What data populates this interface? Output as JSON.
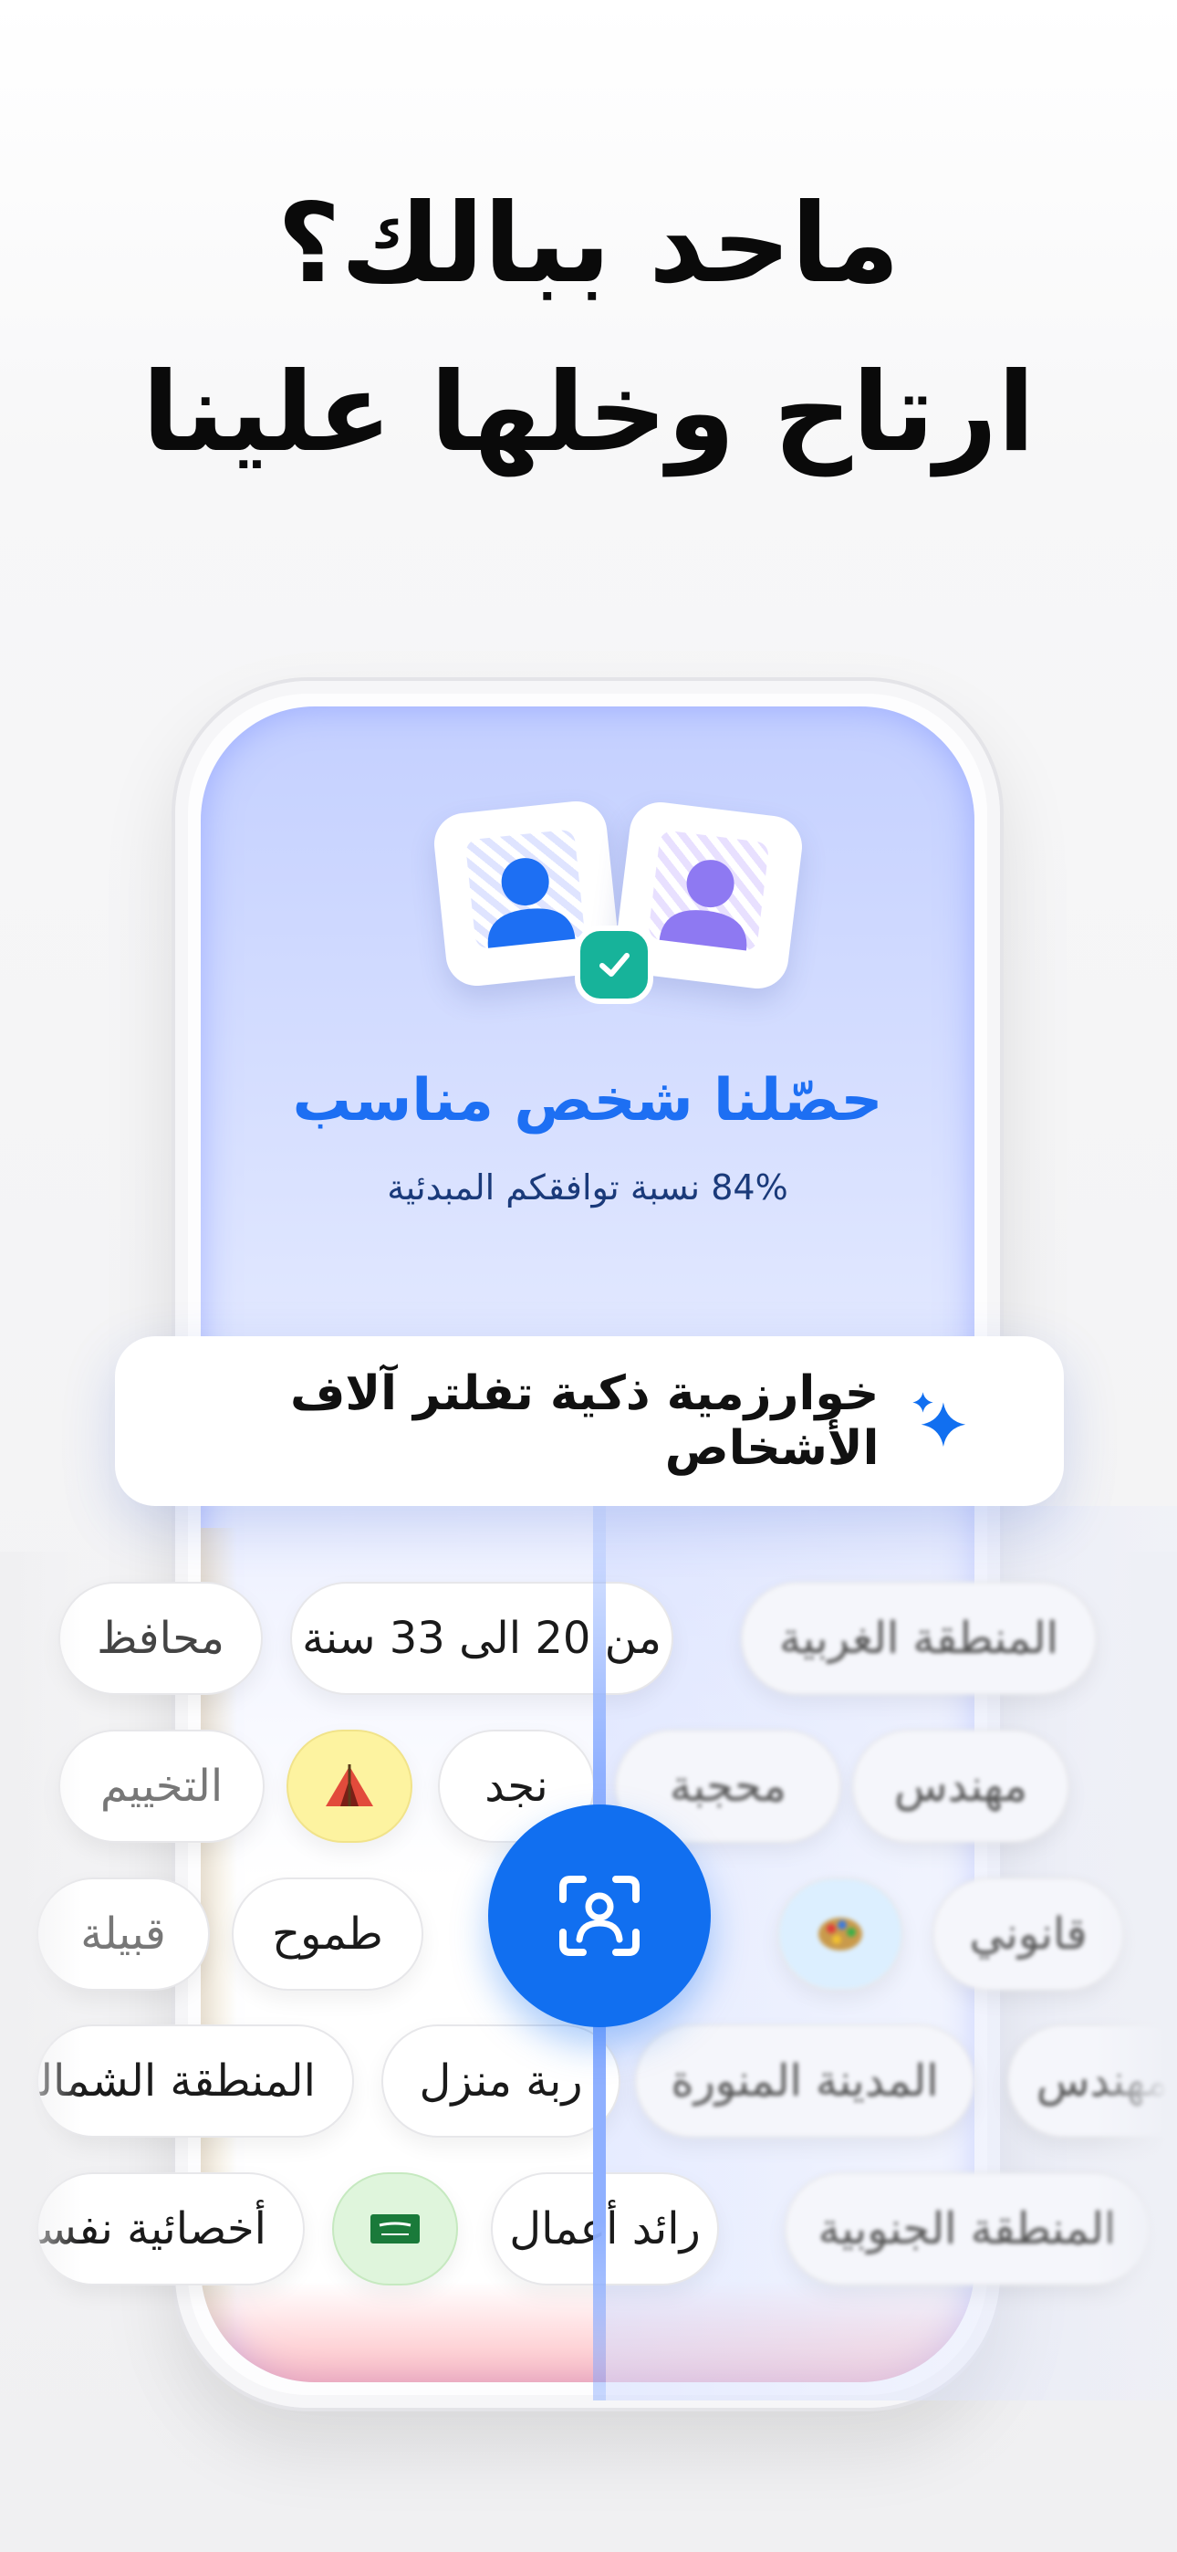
{
  "headline": {
    "line1": "ماحد ببالك؟",
    "line2": "ارتاح وخلها علينا"
  },
  "match_screen": {
    "title": "حصّلنا شخص مناسب",
    "subtitle": "84% نسبة توافقكم المبدئية"
  },
  "algorithm_card": {
    "text": "خوارزمية ذكية تفلتر آلاف الأشخاص",
    "icon": "sparkle-icon"
  },
  "chips": {
    "row1": [
      "محافظ",
      "من 20 الى 33 سنة",
      "المنطقة الغربية"
    ],
    "row2": [
      "التخييم",
      "نجد",
      "محجبة",
      "مهندس"
    ],
    "row3": [
      "قبيلة",
      "طموح",
      "قانوني"
    ],
    "row4": [
      "المنطقة الشمالية",
      "ربة منزل",
      "المدينة المنورة",
      "مهندس"
    ],
    "row5": [
      "أخصائية نفسية",
      "رائد أعمال",
      "المنطقة الجنوبية"
    ]
  },
  "icons": {
    "tent": "tent-icon",
    "flag": "saudi-flag-icon",
    "palette": "palette-icon",
    "scan": "face-scan-icon",
    "check": "check-icon"
  },
  "colors": {
    "accent": "#116ff0",
    "title_blue": "#1d6ff3",
    "check_green": "#17b39a"
  }
}
